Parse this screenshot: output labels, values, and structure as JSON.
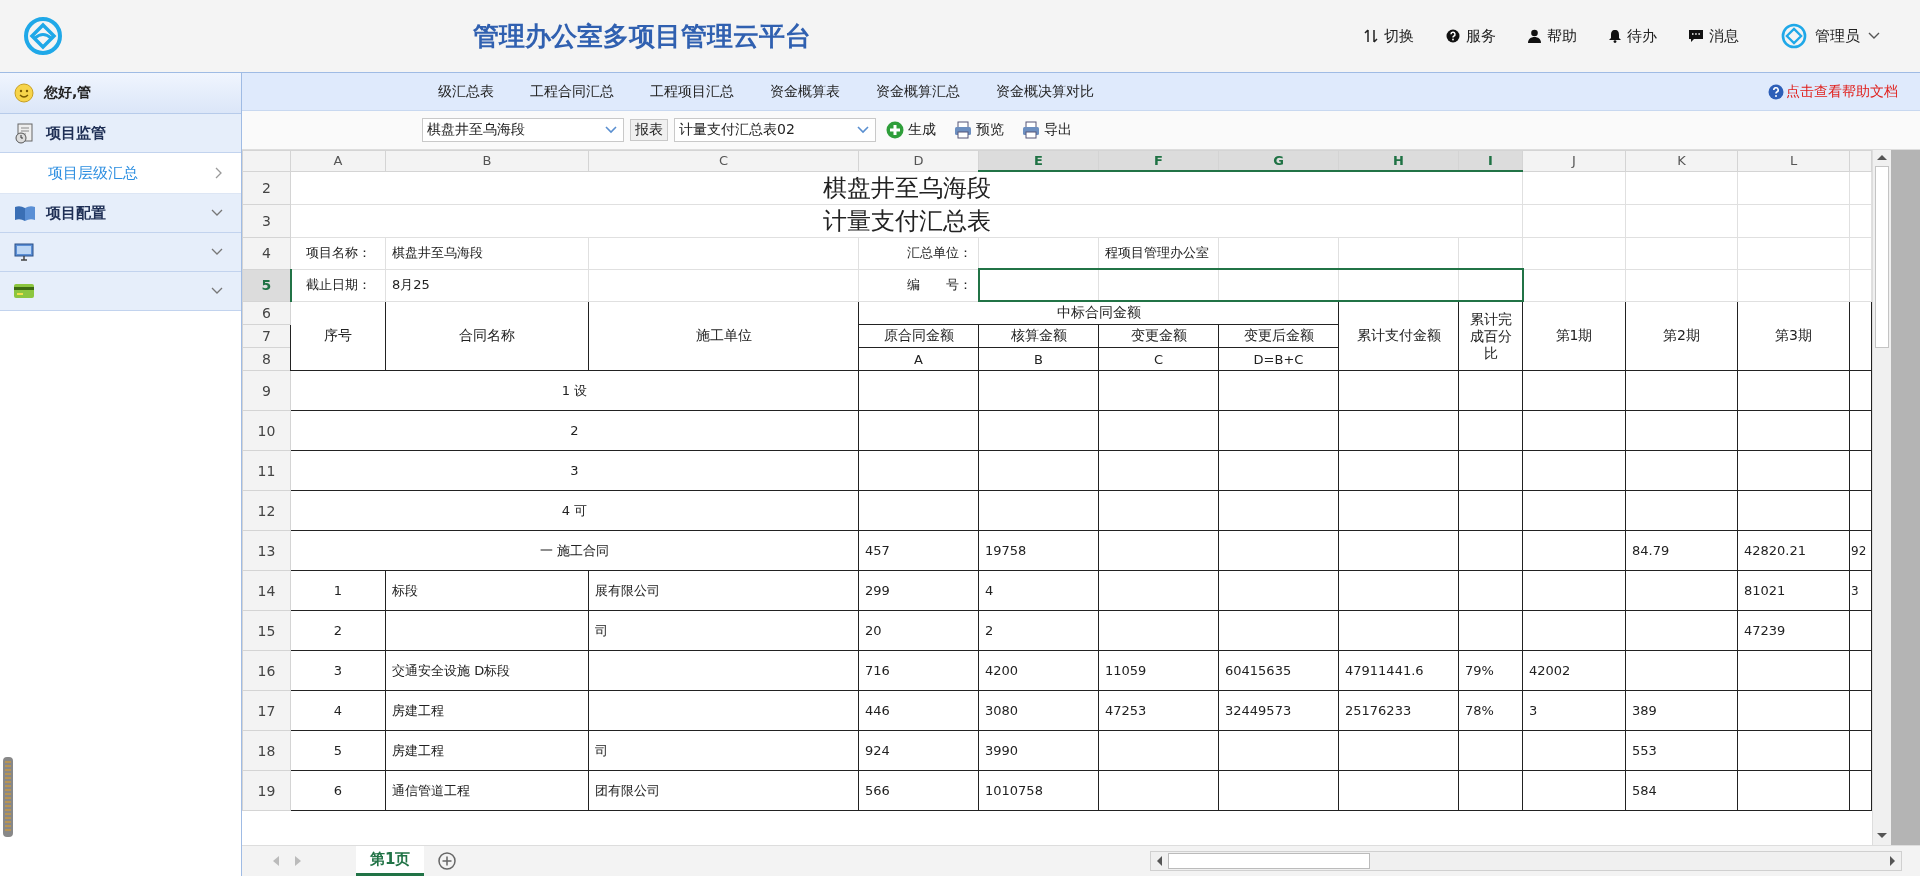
{
  "header": {
    "title": "管理办公室多项目管理云平台",
    "nav": [
      {
        "label": "切换",
        "kind": "switch"
      },
      {
        "label": "服务",
        "kind": "service"
      },
      {
        "label": "帮助",
        "kind": "user"
      },
      {
        "label": "待办",
        "kind": "bell"
      },
      {
        "label": "消息",
        "kind": "message"
      }
    ],
    "user": "管理员"
  },
  "sidebar": {
    "greeting": "您好,管",
    "items": [
      {
        "label": "项目监管",
        "kind": "monitor",
        "children": [
          {
            "label": "项目层级汇总",
            "selected": true
          }
        ]
      },
      {
        "label": "项目配置",
        "kind": "book"
      },
      {
        "kind": "screen"
      },
      {
        "kind": "card"
      }
    ]
  },
  "tabs": [
    {
      "label": "级汇总表"
    },
    {
      "label": "工程合同汇总"
    },
    {
      "label": "工程项目汇总"
    },
    {
      "label": "资金概算表"
    },
    {
      "label": "资金概算汇总"
    },
    {
      "label": "资金概决算对比"
    }
  ],
  "help_link": "点击查看帮助文档",
  "toolbar": {
    "project_select": "棋盘井至乌海段",
    "report_label": "报表",
    "report_select": "计量支付汇总表02",
    "buttons": [
      {
        "label": "生成",
        "kind": "add"
      },
      {
        "label": "预览",
        "kind": "print"
      },
      {
        "label": "导出",
        "kind": "print"
      }
    ]
  },
  "sheet": {
    "columns": [
      {
        "label": "A",
        "selected": false
      },
      {
        "label": "B",
        "selected": false
      },
      {
        "label": "C",
        "selected": false
      },
      {
        "label": "D",
        "selected": false
      },
      {
        "label": "E",
        "selected": true
      },
      {
        "label": "F",
        "selected": true
      },
      {
        "label": "G",
        "selected": true
      },
      {
        "label": "H",
        "selected": true
      },
      {
        "label": "I",
        "selected": true
      },
      {
        "label": "J",
        "selected": false
      },
      {
        "label": "K",
        "selected": false
      },
      {
        "label": "L",
        "selected": false
      }
    ],
    "rows_top": [
      {
        "number": "2",
        "kind": "title",
        "selected": false,
        "text": "棋盘井至乌海段"
      },
      {
        "number": "3",
        "kind": "title",
        "selected": false,
        "text": "计量支付汇总表"
      },
      {
        "number": "4",
        "kind": "plain",
        "selected": false,
        "cells": {
          "A": "项目名称：",
          "B": "棋盘井至乌海段",
          "D": "汇总单位：",
          "F": "程项目管理办公室"
        }
      },
      {
        "number": "5",
        "kind": "plain",
        "selected": true,
        "cells": {
          "A": "截止日期：",
          "B": "8月25",
          "D": "编　　号："
        }
      }
    ],
    "header": {
      "row_numbers": [
        "6",
        "7",
        "8"
      ],
      "seq": "序号",
      "contract": "合同名称",
      "unit": "施工单位",
      "group": "中标合同金额",
      "amounts": [
        {
          "label": "原合同金额",
          "code": "A"
        },
        {
          "label": "核算金额",
          "code": "B"
        },
        {
          "label": "变更金额",
          "code": "C"
        },
        {
          "label": "变更后金额",
          "code": "D=B+C"
        }
      ],
      "paid": "累计支付金额",
      "percent": "累计完成百分比",
      "periods": [
        "第1期",
        "第2期",
        "第3期"
      ]
    },
    "rows": [
      {
        "number": "9",
        "kind": "section",
        "selected": false,
        "text": "1 设",
        "cells": {}
      },
      {
        "number": "10",
        "kind": "section",
        "selected": false,
        "text": "2",
        "cells": {}
      },
      {
        "number": "11",
        "kind": "section",
        "selected": false,
        "text": "3",
        "cells": {}
      },
      {
        "number": "12",
        "kind": "section",
        "selected": false,
        "text": "4 可",
        "cells": {}
      },
      {
        "number": "13",
        "kind": "section",
        "selected": false,
        "text": "一 施工合同",
        "cells": {
          "D": "457",
          "E": "19758",
          "K": "84.79",
          "L": "42820.21",
          "M": "92"
        }
      },
      {
        "number": "14",
        "kind": "data",
        "selected": false,
        "cells": {
          "A": "1",
          "B": "标段",
          "C": "展有限公司",
          "D": "299",
          "E": "4",
          "L": "81021",
          "M": "3"
        }
      },
      {
        "number": "15",
        "kind": "data",
        "selected": false,
        "cells": {
          "A": "2",
          "C": "司",
          "D": "20",
          "E": "2",
          "L": "47239"
        }
      },
      {
        "number": "16",
        "kind": "data",
        "selected": false,
        "cells": {
          "A": "3",
          "B": "交通安全设施 D标段",
          "D": "716",
          "E": "4200",
          "F": "11059",
          "G": "60415635",
          "H": "47911441.6",
          "I": "79%",
          "J": "42002"
        }
      },
      {
        "number": "17",
        "kind": "data",
        "selected": false,
        "cells": {
          "A": "4",
          "B": "房建工程",
          "D": "446",
          "E": "3080",
          "F": "47253",
          "G": "32449573",
          "H": "25176233",
          "I": "78%",
          "J": "3",
          "K": "389"
        }
      },
      {
        "number": "18",
        "kind": "data",
        "selected": false,
        "cells": {
          "A": "5",
          "B": "房建工程",
          "C": "司",
          "D": "924",
          "E": "3990",
          "K": "553"
        }
      },
      {
        "number": "19",
        "kind": "data",
        "selected": false,
        "cells": {
          "A": "6",
          "B": "通信管道工程",
          "C": "团有限公司",
          "D": "566",
          "E": "1010758",
          "K": "584"
        }
      }
    ]
  },
  "sheet_tabs": [
    {
      "label": "第1页",
      "selected": true
    }
  ]
}
